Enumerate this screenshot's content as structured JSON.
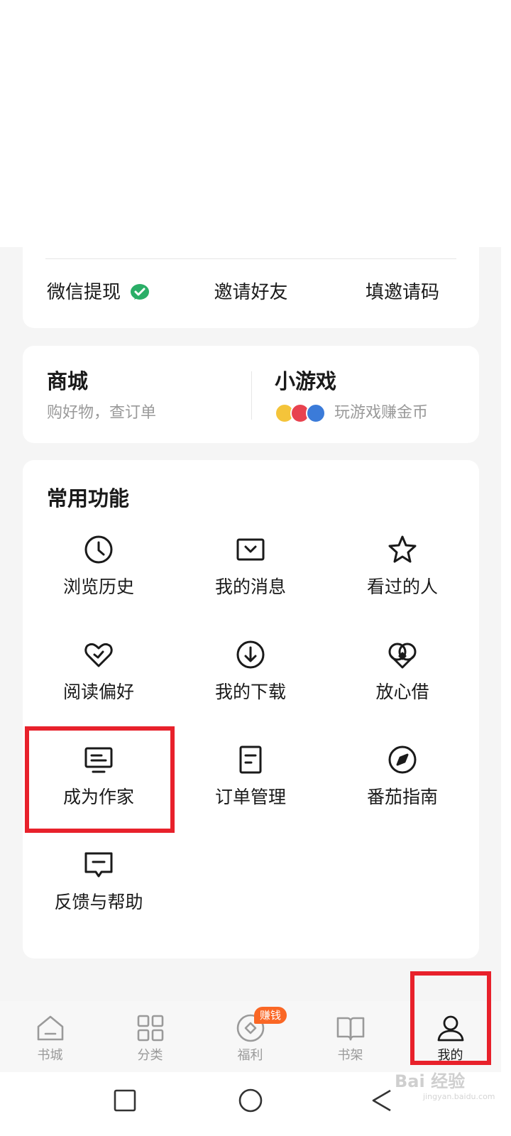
{
  "withdraw": {
    "items": [
      "微信提现",
      "邀请好友",
      "填邀请码"
    ]
  },
  "mall": {
    "title": "商城",
    "subtitle": "购好物，查订单"
  },
  "games": {
    "title": "小游戏",
    "subtitle": "玩游戏赚金币"
  },
  "functions": {
    "title": "常用功能",
    "items": [
      {
        "label": "浏览历史",
        "icon": "clock-icon"
      },
      {
        "label": "我的消息",
        "icon": "message-icon"
      },
      {
        "label": "看过的人",
        "icon": "star-icon"
      },
      {
        "label": "阅读偏好",
        "icon": "heart-icon"
      },
      {
        "label": "我的下载",
        "icon": "download-icon"
      },
      {
        "label": "放心借",
        "icon": "loan-icon"
      },
      {
        "label": "成为作家",
        "icon": "monitor-icon"
      },
      {
        "label": "订单管理",
        "icon": "order-icon"
      },
      {
        "label": "番茄指南",
        "icon": "compass-icon"
      },
      {
        "label": "反馈与帮助",
        "icon": "feedback-icon"
      }
    ]
  },
  "nav": {
    "items": [
      {
        "label": "书城",
        "icon": "home-icon"
      },
      {
        "label": "分类",
        "icon": "grid-icon"
      },
      {
        "label": "福利",
        "icon": "coin-icon",
        "badge": "赚钱"
      },
      {
        "label": "书架",
        "icon": "book-icon"
      },
      {
        "label": "我的",
        "icon": "person-icon",
        "active": true
      }
    ]
  },
  "watermark": {
    "text": "Bai 经验",
    "sub": "jingyan.baidu.com"
  },
  "colors": {
    "accent_badge": "#fa6725",
    "highlight": "#e8212b",
    "wechat": "#2aae67"
  }
}
